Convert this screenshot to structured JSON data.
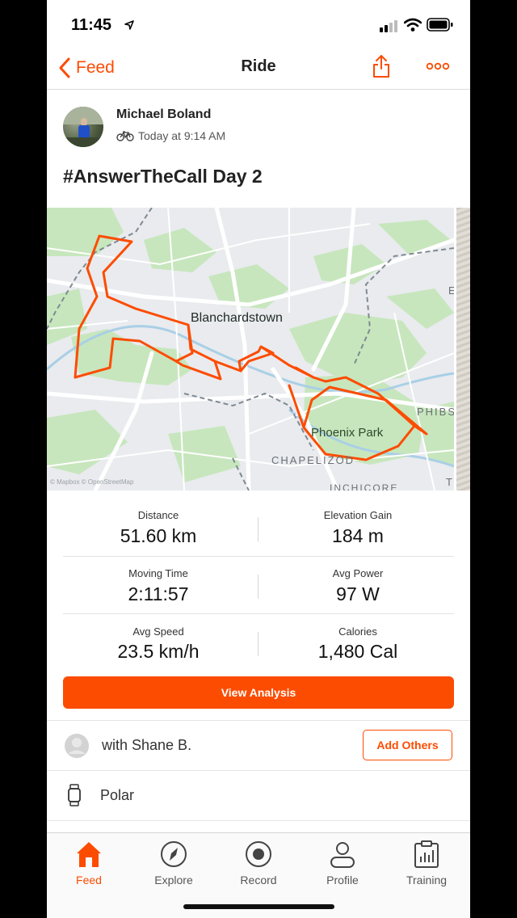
{
  "status_bar": {
    "time": "11:45"
  },
  "nav": {
    "back_label": "Feed",
    "title": "Ride"
  },
  "activity": {
    "athlete_name": "Michael Boland",
    "timestamp": "Today at 9:14 AM",
    "title": "#AnswerTheCall Day 2"
  },
  "map": {
    "labels": {
      "town": "Blanchardstown",
      "park": "Phoenix Park",
      "chapelizod": "CHAPELIZOD",
      "phibs": "PHIBS",
      "inchicore": "INCHICORE",
      "edge_e": "E",
      "edge_t": "T"
    },
    "attribution": "© Mapbox © OpenStreetMap",
    "route_color": "#fc4c02"
  },
  "stats": [
    {
      "label": "Distance",
      "value": "51.60 km"
    },
    {
      "label": "Elevation Gain",
      "value": "184 m"
    },
    {
      "label": "Moving Time",
      "value": "2:11:57"
    },
    {
      "label": "Avg Power",
      "value": "97 W"
    },
    {
      "label": "Avg Speed",
      "value": "23.5 km/h"
    },
    {
      "label": "Calories",
      "value": "1,480 Cal"
    }
  ],
  "actions": {
    "view_analysis": "View Analysis",
    "add_others": "Add Others"
  },
  "group": {
    "with_text": "with Shane B."
  },
  "device": {
    "name": "Polar"
  },
  "tabs": [
    {
      "label": "Feed",
      "icon": "home-icon",
      "active": true
    },
    {
      "label": "Explore",
      "icon": "compass-icon",
      "active": false
    },
    {
      "label": "Record",
      "icon": "record-icon",
      "active": false
    },
    {
      "label": "Profile",
      "icon": "profile-icon",
      "active": false
    },
    {
      "label": "Training",
      "icon": "training-icon",
      "active": false
    }
  ],
  "colors": {
    "accent": "#fc4c02",
    "park_green": "#bfe3b4"
  }
}
